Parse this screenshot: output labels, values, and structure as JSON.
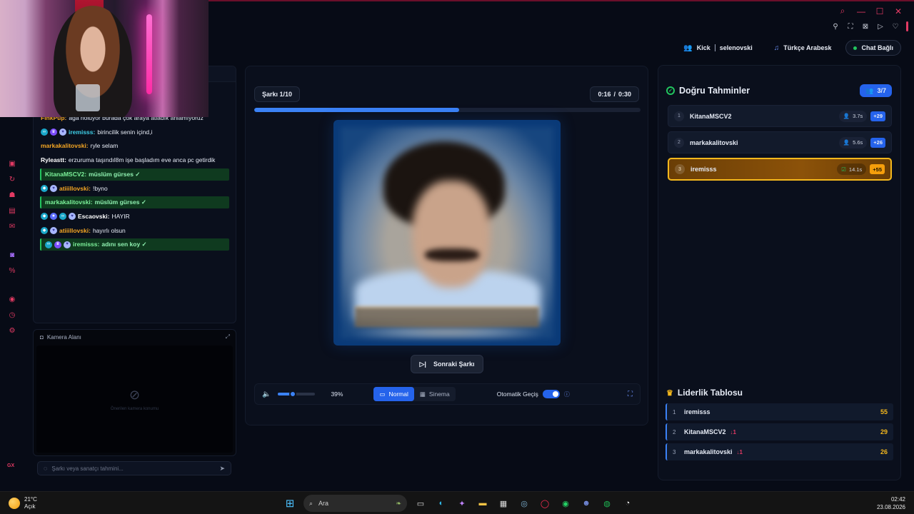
{
  "header": {
    "platform": "Kick",
    "channel": "selenovski",
    "category": "Türkçe Arabesk",
    "chat_status": "Chat Bağlı"
  },
  "chat": {
    "messages": [
      {
        "user": "FinkPup",
        "text": "ağa noluyor burada çok araya atladık anlamıyoruz",
        "user_color": "orange",
        "badges": [],
        "correct": false
      },
      {
        "user": "iremisss",
        "text": "birincilik senin içind,i",
        "user_color": "cyan",
        "badges": [
          "infinity-badge",
          "crown-badge",
          "heart-badge"
        ],
        "correct": false
      },
      {
        "user": "markakalitovski",
        "text": "ryle selam",
        "user_color": "orange",
        "badges": [],
        "correct": false
      },
      {
        "user": "Ryleastt",
        "text": "erzuruma taşındıl8m işe başladım eve anca pc getirdik",
        "user_color": "white",
        "badges": [],
        "correct": false
      },
      {
        "user": "KitanaMSCV2",
        "text": "müslüm gürses ✓",
        "user_color": "green",
        "badges": [],
        "correct": true
      },
      {
        "user": "atiiillovski",
        "text": "!byno",
        "user_color": "orange",
        "badges": [
          "shield-badge",
          "heart-badge"
        ],
        "correct": false
      },
      {
        "user": "markakalitovski",
        "text": "müslüm gürses ✓",
        "user_color": "green",
        "badges": [],
        "correct": true
      },
      {
        "user": "Escaovski",
        "text": "HAYIR",
        "user_color": "white",
        "badges": [
          "shield-badge",
          "star-badge",
          "infinity-badge",
          "heart-badge"
        ],
        "correct": false
      },
      {
        "user": "atiiillovski",
        "text": "hayırlı olsun",
        "user_color": "orange",
        "badges": [
          "shield-badge",
          "heart-badge"
        ],
        "correct": false
      },
      {
        "user": "iremisss",
        "text": "adını sen koy ✓",
        "user_color": "green",
        "badges": [
          "infinity-badge",
          "crown-badge",
          "heart-badge"
        ],
        "correct": true
      }
    ]
  },
  "camera": {
    "title": "Kamera Alanı",
    "hint": "Önerilen kamera konumu"
  },
  "guess_input": {
    "placeholder": "Şarkı veya sanatçı tahmini..."
  },
  "player": {
    "song_counter": "Şarkı 1/10",
    "elapsed": "0:16",
    "separator": "/",
    "duration": "0:30",
    "progress_fraction": 0.53,
    "next_label": "Sonraki Şarkı",
    "volume_fraction": 0.39,
    "volume_label": "39%",
    "modes": [
      "Normal",
      "Sinema"
    ],
    "active_mode": "Normal",
    "auto_label": "Otomatik Geçiş",
    "auto_on": true
  },
  "guesses": {
    "title": "Doğru Tahminler",
    "count": "3/7",
    "rows": [
      {
        "rank": "1",
        "name": "KitanaMSCV2",
        "time": "3.7s",
        "points": "+29"
      },
      {
        "rank": "2",
        "name": "markakalitovski",
        "time": "5.6s",
        "points": "+26"
      },
      {
        "rank": "3",
        "name": "iremisss",
        "time": "14.1s",
        "points": "+55"
      }
    ]
  },
  "leaderboard": {
    "title": "Liderlik Tablosu",
    "rows": [
      {
        "rank": "1",
        "name": "iremisss",
        "change": "",
        "score": "55"
      },
      {
        "rank": "2",
        "name": "KitanaMSCV2",
        "change": "↓1",
        "score": "29"
      },
      {
        "rank": "3",
        "name": "markakalitovski",
        "change": "↓1",
        "score": "26"
      }
    ]
  },
  "taskbar": {
    "temperature": "21°C",
    "weather": "Açık",
    "search": "Ara",
    "time": "02:42",
    "date": "23.08.2026"
  },
  "colors": {
    "accent": "#2563eb",
    "correct_green": "#22c55e",
    "gold": "#f5b81c",
    "rail_red": "#e23a63"
  }
}
